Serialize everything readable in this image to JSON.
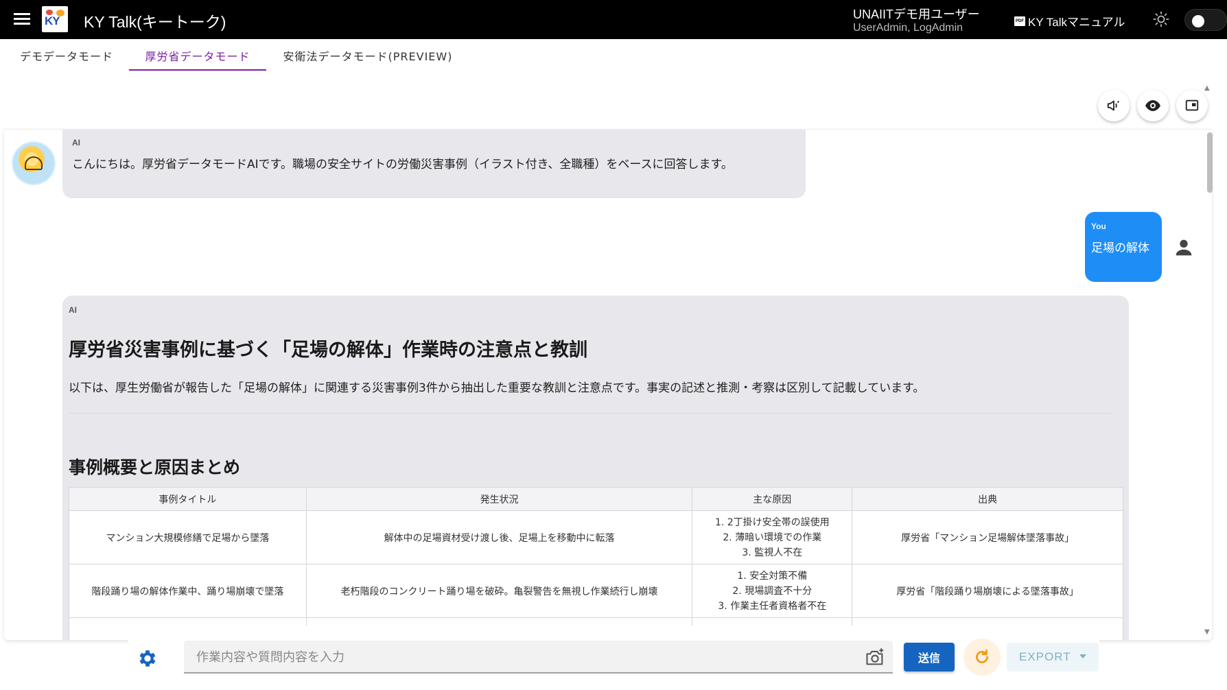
{
  "header": {
    "app_title": "KY Talk(キートーク)",
    "user_name": "UNAIITデモ用ユーザー",
    "user_roles": "UserAdmin, LogAdmin",
    "manual_label": "KY Talkマニュアル",
    "logo_text": "KY"
  },
  "tabs": [
    {
      "label": "デモデータモード"
    },
    {
      "label": "厚労省データモード"
    },
    {
      "label": "安衛法データモード(PREVIEW)"
    }
  ],
  "active_tab": "厚労省データモード",
  "messages": {
    "ai_1": {
      "role": "AI",
      "text": "こんにちは。厚労省データモードAIです。職場の安全サイトの労働災害事例（イラスト付き、全職種）をベースに回答します。"
    },
    "user_1": {
      "role": "You",
      "text": "足場の解体"
    },
    "ai_2": {
      "role": "AI",
      "heading": "厚労省災害事例に基づく「足場の解体」作業時の注意点と教訓",
      "intro": "以下は、厚生労働省が報告した「足場の解体」に関連する災害事例3件から抽出した重要な教訓と注意点です。事実の記述と推測・考察は区別して記載しています。",
      "section_title": "事例概要と原因まとめ",
      "table": {
        "headers": [
          "事例タイトル",
          "発生状況",
          "主な原因",
          "出典"
        ],
        "rows": [
          {
            "title": "マンション大規模修繕で足場から墜落",
            "situation": "解体中の足場資材受け渡し後、足場上を移動中に転落",
            "causes": [
              "1. 2丁掛け安全帯の誤使用",
              "2. 薄暗い環境での作業",
              "3. 監視人不在"
            ],
            "source": "厚労省「マンション足場解体墜落事故」"
          },
          {
            "title": "階段踊り場の解体作業中、踊り場崩壊で墜落",
            "situation": "老朽階段のコンクリート踊り場を破砕。亀裂警告を無視し作業続行し崩壊",
            "causes": [
              "1. 安全対策不備",
              "2. 現場調査不十分",
              "3. 作業主任者資格者不在"
            ],
            "source": "厚労省「階段踊り場崩壊による墜落事故」"
          }
        ]
      }
    }
  },
  "input": {
    "placeholder": "作業内容や質問内容を入力",
    "value": ""
  },
  "buttons": {
    "send": "送信",
    "export": "EXPORT"
  },
  "colors": {
    "topbar": "#000000",
    "active_tab": "#7b1fa2",
    "user_bubble": "#1e8ef6",
    "ai_bubble": "#e8e8ec",
    "send_button": "#1565c0",
    "refresh_icon": "#f39c12"
  },
  "icons": {
    "menu": "hamburger-menu-icon",
    "theme": "sun-icon",
    "announce": "megaphone-icon",
    "view": "eye-icon",
    "panel": "window-icon",
    "user": "person-icon",
    "settings": "gear-icon",
    "camera": "camera-add-icon",
    "refresh": "refresh-icon"
  }
}
